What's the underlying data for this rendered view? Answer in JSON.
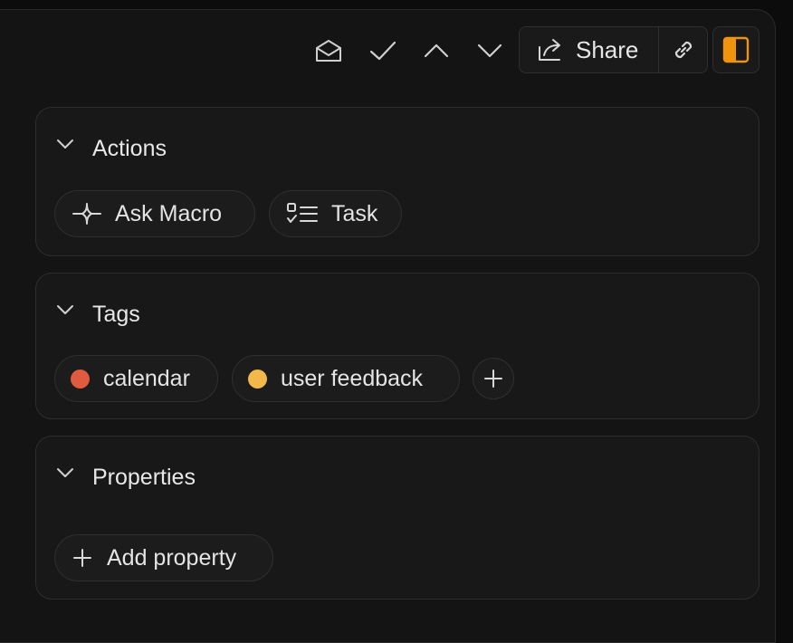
{
  "toolbar": {
    "icons": [
      "envelope-open-icon",
      "check-icon",
      "chevron-up-icon",
      "chevron-down-icon"
    ],
    "share_label": "Share",
    "link_icon": "link-icon",
    "panel_icon": "sidebar-panel-icon"
  },
  "sections": {
    "actions": {
      "title": "Actions",
      "items": [
        {
          "label": "Ask Macro",
          "icon": "sparkle-icon"
        },
        {
          "label": "Task",
          "icon": "checklist-icon"
        }
      ]
    },
    "tags": {
      "title": "Tags",
      "items": [
        {
          "label": "calendar",
          "color": "#e05a3f"
        },
        {
          "label": "user feedback",
          "color": "#f2b84b"
        }
      ]
    },
    "properties": {
      "title": "Properties",
      "add_label": "Add property"
    }
  },
  "colors": {
    "accent": "#f0940e",
    "text": "#e6e6e6",
    "icon": "#cfcfcf"
  }
}
